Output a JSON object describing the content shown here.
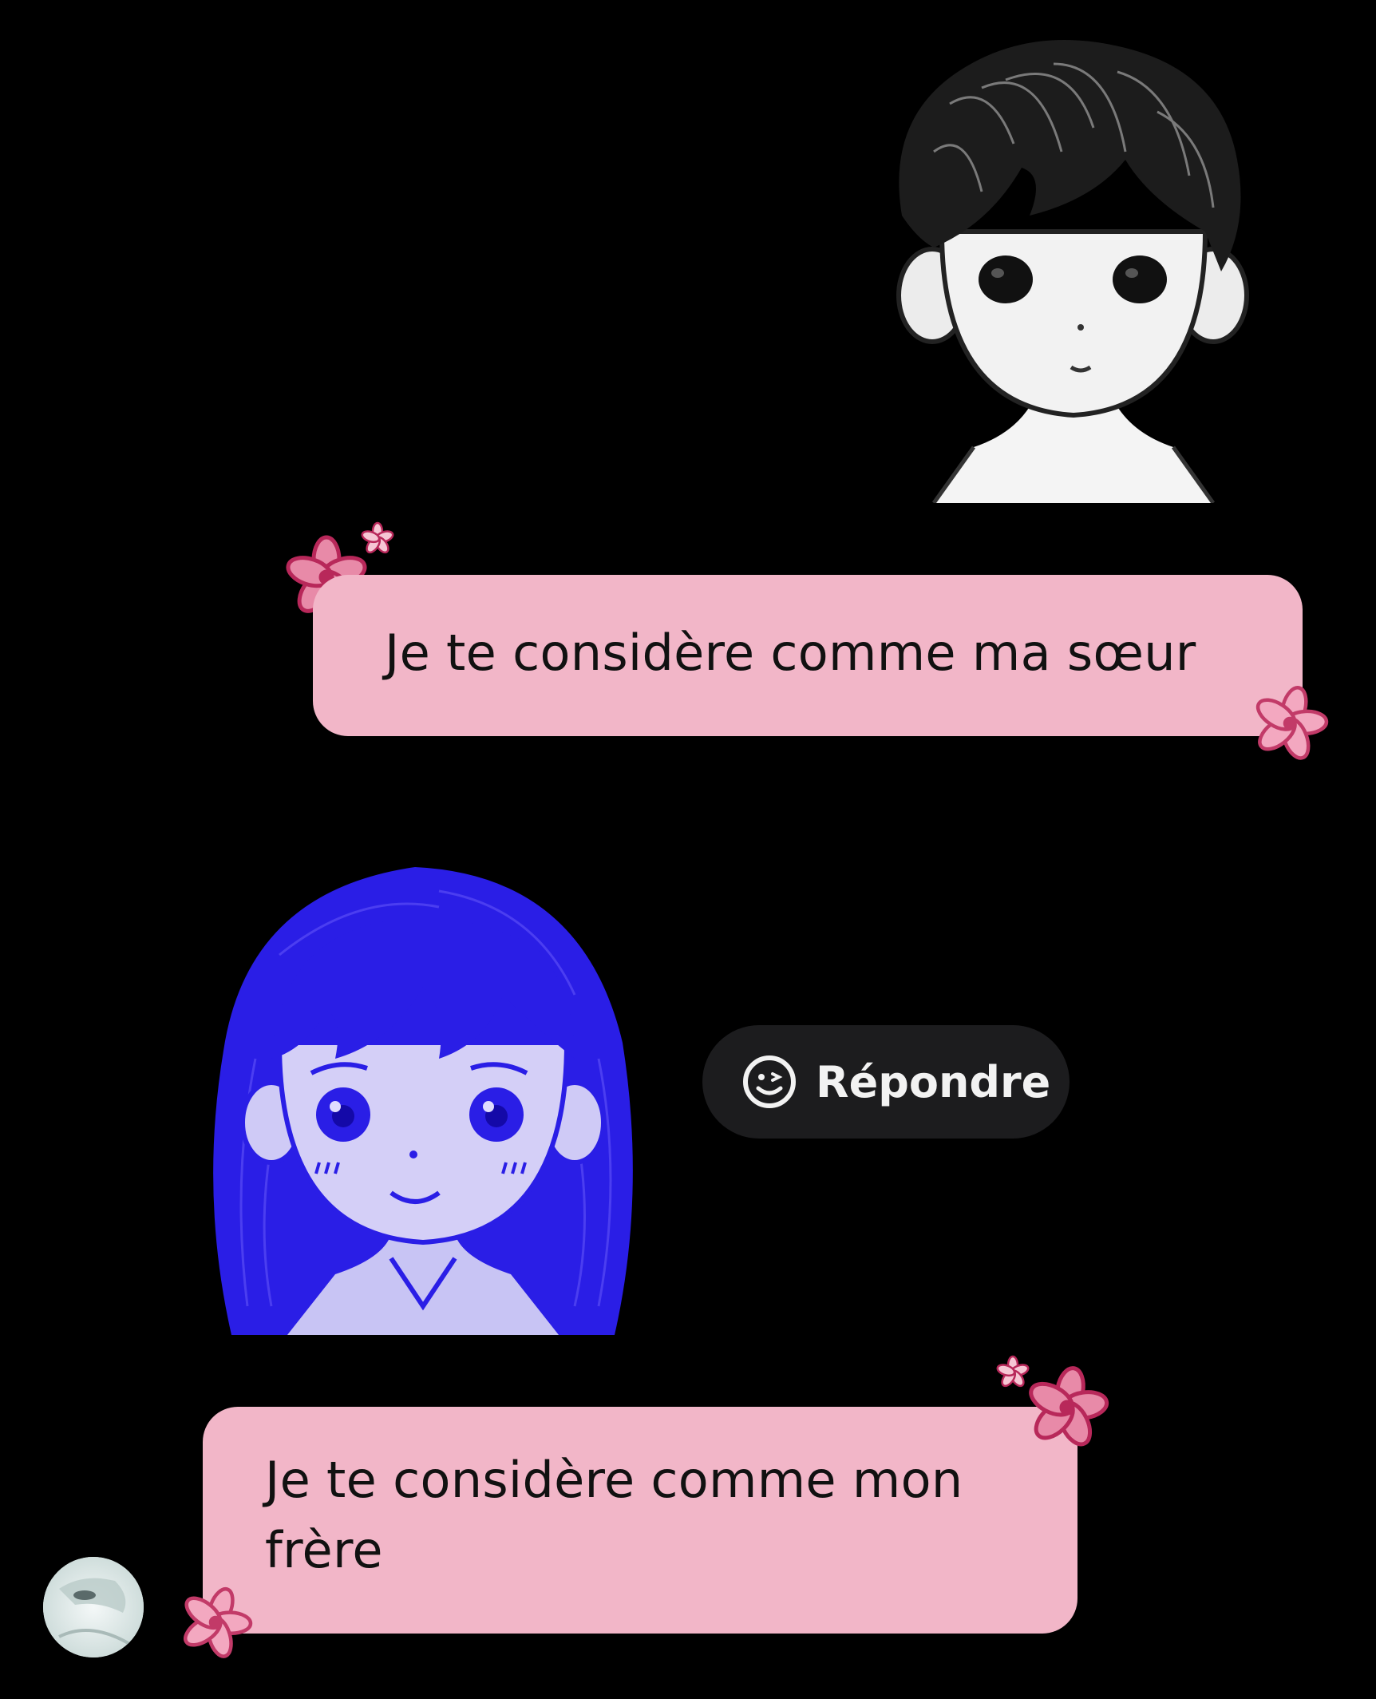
{
  "messages": [
    {
      "direction": "outgoing",
      "sticker": "boy-character-sticker",
      "text": "Je te considère comme ma sœur"
    },
    {
      "direction": "incoming",
      "sticker": "girl-character-sticker",
      "text": "Je te considère comme mon frère"
    }
  ],
  "reply_action": {
    "label": "Répondre",
    "icon": "smiley-icon"
  },
  "sender_avatar": {
    "icon": "avatar-image"
  },
  "colors": {
    "background": "#000000",
    "bubble": "#f2b6c8",
    "bubble_text": "#111111",
    "flower_accent": "#d23a6a",
    "reply_pill": "#1c1c1e",
    "sticker_blue": "#2a1ee6"
  }
}
